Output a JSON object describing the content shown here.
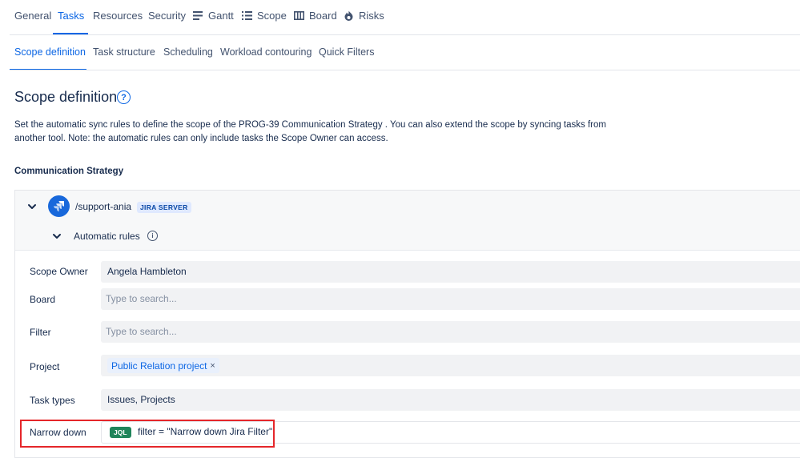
{
  "top_tabs": [
    {
      "label": "General",
      "icon": ""
    },
    {
      "label": "Tasks",
      "icon": "",
      "active": true
    },
    {
      "label": "Resources",
      "icon": ""
    },
    {
      "label": "Security",
      "icon": ""
    },
    {
      "label": "Gantt",
      "icon": "gantt-icon"
    },
    {
      "label": "Scope",
      "icon": "scope-list-icon"
    },
    {
      "label": "Board",
      "icon": "board-icon"
    },
    {
      "label": "Risks",
      "icon": "risks-flame-icon"
    }
  ],
  "sub_tabs": [
    {
      "label": "Scope definition",
      "active": true
    },
    {
      "label": "Task structure"
    },
    {
      "label": "Scheduling"
    },
    {
      "label": "Workload contouring"
    },
    {
      "label": "Quick Filters"
    }
  ],
  "page": {
    "title": "Scope definition",
    "help_glyph": "?",
    "description": "Set the automatic sync rules to define the scope of the PROG-39 Communication Strategy . You can also extend the scope by syncing tasks from another tool. Note: the automatic rules can only include tasks the Scope Owner can access.",
    "section_title": "Communication Strategy"
  },
  "connection": {
    "name": "/support-ania",
    "badge": "JIRA SERVER",
    "rules_label": "Automatic rules",
    "info_glyph": "i"
  },
  "fields": {
    "scope_owner": {
      "label": "Scope Owner",
      "value": "Angela Hambleton"
    },
    "board": {
      "label": "Board",
      "placeholder": "Type to search..."
    },
    "filter": {
      "label": "Filter",
      "placeholder": "Type to search..."
    },
    "project": {
      "label": "Project",
      "chip": "Public Relation project",
      "chip_remove": "×"
    },
    "task_types": {
      "label": "Task types",
      "value": "Issues, Projects"
    },
    "narrow_down": {
      "label": "Narrow down",
      "badge": "JQL",
      "value": "filter = \"Narrow down Jira Filter\""
    }
  },
  "colors": {
    "accent": "#0c66e4",
    "highlight": "#e5262a",
    "jql_badge": "#1f845a",
    "field_bg": "#f1f2f4"
  }
}
